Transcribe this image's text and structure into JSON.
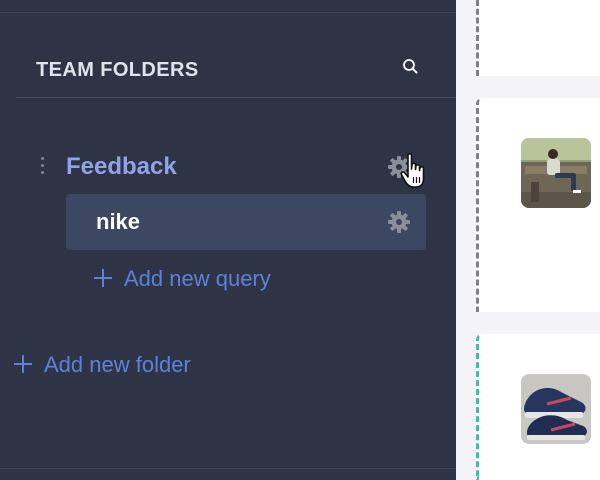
{
  "sidebar": {
    "section_title": "TEAM FOLDERS",
    "folders": [
      {
        "name": "Feedback",
        "queries": [
          {
            "name": "nike"
          }
        ],
        "add_query_label": "Add new query"
      }
    ],
    "add_folder_label": "Add new folder"
  },
  "colors": {
    "sidebar_bg": "#2e3446",
    "selected_query_bg": "#3e4761",
    "folder_name": "#8fa4e6",
    "accent_link": "#5b82d8",
    "card_border_gray": "#7f7f85",
    "card_border_teal": "#3dbfa7"
  },
  "icons": {
    "search": "search-icon",
    "settings": "gear-icon",
    "drag": "drag-handle-icon",
    "add": "plus-icon",
    "cursor": "hand-pointer-cursor-icon"
  },
  "content": {
    "cards": [
      {
        "image": "photo-man-on-sofa",
        "border": "gray"
      },
      {
        "image": "photo-sneakers",
        "border": "teal"
      }
    ]
  }
}
